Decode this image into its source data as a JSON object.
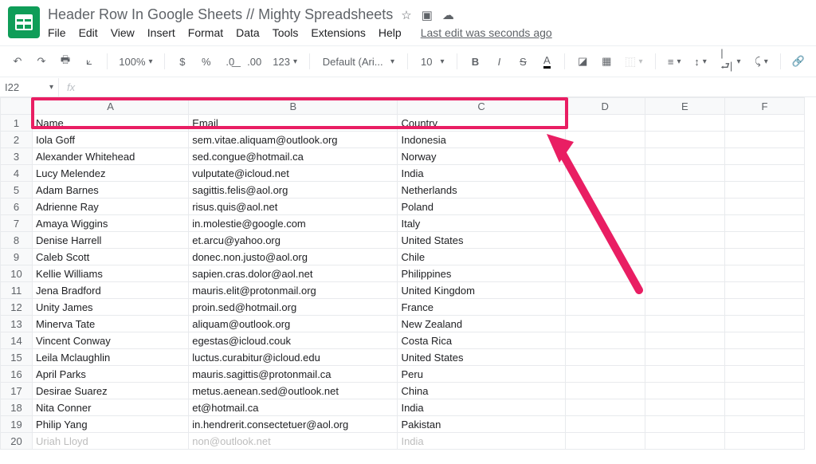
{
  "doc": {
    "title": "Header Row In Google Sheets // Mighty Spreadsheets",
    "last_edit": "Last edit was seconds ago"
  },
  "menu": [
    "File",
    "Edit",
    "View",
    "Insert",
    "Format",
    "Data",
    "Tools",
    "Extensions",
    "Help"
  ],
  "toolbar": {
    "zoom": "100%",
    "font": "Default (Ari...",
    "fontsize": "10"
  },
  "namebox": "I22",
  "columns": [
    "A",
    "B",
    "C",
    "D",
    "E",
    "F"
  ],
  "headers": {
    "A": "Name",
    "B": "Email",
    "C": "Country"
  },
  "rows": [
    {
      "n": "Iola Goff",
      "e": "sem.vitae.aliquam@outlook.org",
      "c": "Indonesia"
    },
    {
      "n": "Alexander Whitehead",
      "e": "sed.congue@hotmail.ca",
      "c": "Norway"
    },
    {
      "n": "Lucy Melendez",
      "e": "vulputate@icloud.net",
      "c": "India"
    },
    {
      "n": "Adam Barnes",
      "e": "sagittis.felis@aol.org",
      "c": "Netherlands"
    },
    {
      "n": "Adrienne Ray",
      "e": "risus.quis@aol.net",
      "c": "Poland"
    },
    {
      "n": "Amaya Wiggins",
      "e": "in.molestie@google.com",
      "c": "Italy"
    },
    {
      "n": "Denise Harrell",
      "e": "et.arcu@yahoo.org",
      "c": "United States"
    },
    {
      "n": "Caleb Scott",
      "e": "donec.non.justo@aol.org",
      "c": "Chile"
    },
    {
      "n": "Kellie Williams",
      "e": "sapien.cras.dolor@aol.net",
      "c": "Philippines"
    },
    {
      "n": "Jena Bradford",
      "e": "mauris.elit@protonmail.org",
      "c": "United Kingdom"
    },
    {
      "n": "Unity James",
      "e": "proin.sed@hotmail.org",
      "c": "France"
    },
    {
      "n": "Minerva Tate",
      "e": "aliquam@outlook.org",
      "c": "New Zealand"
    },
    {
      "n": "Vincent Conway",
      "e": "egestas@icloud.couk",
      "c": "Costa Rica"
    },
    {
      "n": "Leila Mclaughlin",
      "e": "luctus.curabitur@icloud.edu",
      "c": "United States"
    },
    {
      "n": "April Parks",
      "e": "mauris.sagittis@protonmail.ca",
      "c": "Peru"
    },
    {
      "n": "Desirae Suarez",
      "e": "metus.aenean.sed@outlook.net",
      "c": "China"
    },
    {
      "n": "Nita Conner",
      "e": "et@hotmail.ca",
      "c": "India"
    },
    {
      "n": "Philip Yang",
      "e": "in.hendrerit.consectetuer@aol.org",
      "c": "Pakistan"
    },
    {
      "n": "Uriah Lloyd",
      "e": "non@outlook.net",
      "c": "India"
    }
  ]
}
